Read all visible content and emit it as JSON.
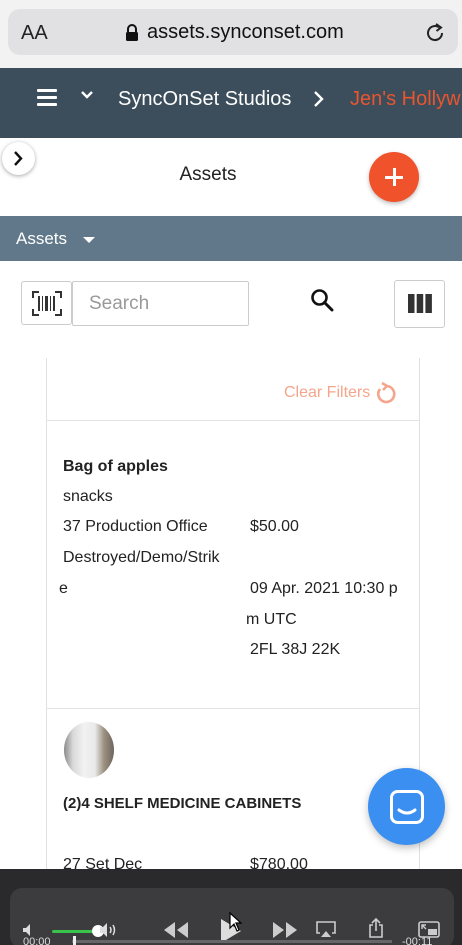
{
  "browser": {
    "text_size_label": "AA",
    "url": "assets.synconset.com"
  },
  "header": {
    "studio": "SyncOnSet Studios",
    "project": "Jen's Hollyw",
    "project_color": "#e8552e",
    "background": "#3c4e5b"
  },
  "page": {
    "title": "Assets",
    "add_color": "#f0522b"
  },
  "assets_dropdown": {
    "label": "Assets"
  },
  "toolbar": {
    "search_placeholder": "Search"
  },
  "filters": {
    "clear_label": "Clear Filters",
    "clear_color": "#f4a58b"
  },
  "items": [
    {
      "name": "Bag of apples",
      "category": "snacks",
      "location": "37 Production Office",
      "status_line1": "Destroyed/Demo/Strik",
      "status_line2": "e",
      "price": "$50.00",
      "date_line1": "09 Apr. 2021 10:30 p",
      "date_line2": "m UTC",
      "code": "2FL 38J 22K"
    },
    {
      "name": "(2)4 SHELF MEDICINE CABINETS",
      "location": "27 Set Dec",
      "price": "$780.00"
    }
  ],
  "media": {
    "time_start": "00:00",
    "time_end": "-00:11",
    "volume_level": 0.8,
    "accent": "#38c34a"
  },
  "chat": {
    "color": "#3b8ff0"
  }
}
